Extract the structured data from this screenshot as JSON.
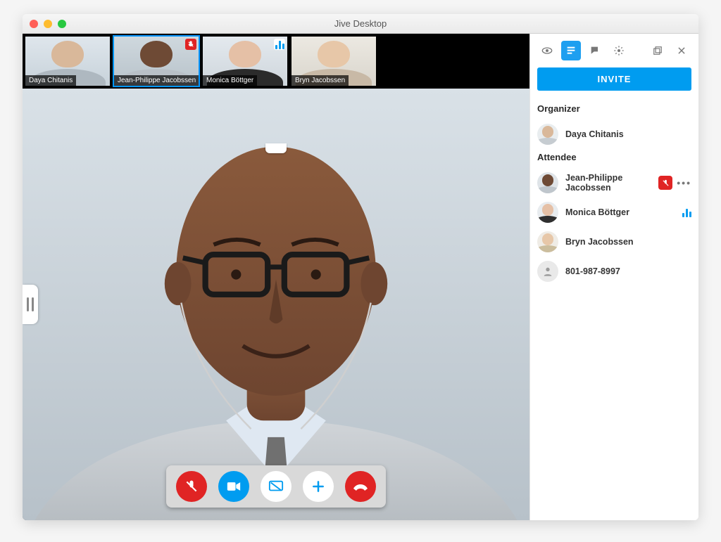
{
  "window": {
    "title": "Jive Desktop"
  },
  "thumbnails": [
    {
      "name": "Daya Chitanis",
      "badge": null,
      "active": false
    },
    {
      "name": "Jean-Philippe Jacobssen",
      "badge": "mute",
      "active": true
    },
    {
      "name": "Monica Böttger",
      "badge": "speak",
      "active": false
    },
    {
      "name": "Bryn Jacobssen",
      "badge": null,
      "active": false
    }
  ],
  "main_speaker": "Jean-Philippe Jacobssen",
  "controls": {
    "mute": "mic-muted-icon",
    "camera": "camera-icon",
    "share": "screen-share-icon",
    "add": "plus-icon",
    "hangup": "hangup-icon"
  },
  "sidebar": {
    "invite_label": "INVITE",
    "sections": {
      "organizer_label": "Organizer",
      "attendee_label": "Attendee"
    },
    "organizer": {
      "name": "Daya Chitanis"
    },
    "attendees": [
      {
        "name": "Jean-Philippe Jacobssen",
        "status": "muted",
        "more": true
      },
      {
        "name": "Monica Böttger",
        "status": "speaking",
        "more": false
      },
      {
        "name": "Bryn Jacobssen",
        "status": null,
        "more": false
      },
      {
        "name": "801-987-8997",
        "status": null,
        "phone": true
      }
    ]
  }
}
